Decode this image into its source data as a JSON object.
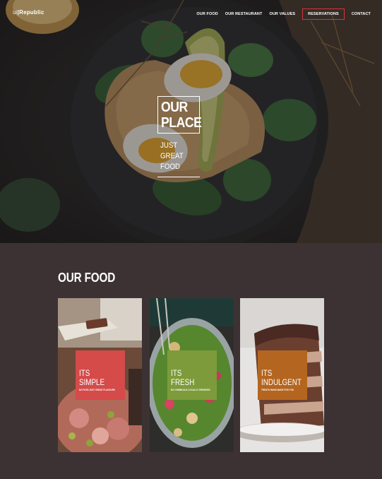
{
  "logo": {
    "prefix": "ui",
    "name": "Republic"
  },
  "nav": {
    "items": [
      "OUR FOOD",
      "OUR RESTAURANT",
      "OUR VALUES",
      "RESERVATIONS",
      "CONTACT"
    ],
    "highlight_color": "#d9333a"
  },
  "hero": {
    "title_line1": "OUR",
    "title_line2": "PLACE",
    "sub_line1": "JUST",
    "sub_line2": "GREAT",
    "sub_line3": "FOOD"
  },
  "food_section": {
    "heading": "OUR FOOD",
    "cards": [
      {
        "line1": "ITS",
        "line2": "SIMPLE",
        "caption": "NO FUSS JUST GREAT FLAVOURS",
        "color": "#d44b4a"
      },
      {
        "line1": "ITS",
        "line2": "FRESH",
        "caption": "NO CHEMICALS LOCALLY GROWCED",
        "color": "#7d9b3a"
      },
      {
        "line1": "ITS",
        "line2": "INDULGENT",
        "caption": "TREATS HAND MADE FOR YOU",
        "color": "#b4651f"
      }
    ]
  }
}
